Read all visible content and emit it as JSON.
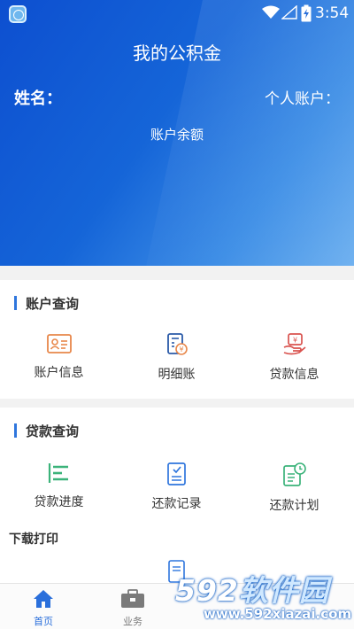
{
  "status_bar": {
    "time": "3:54"
  },
  "header": {
    "title": "我的公积金",
    "name_label": "姓名：",
    "account_label": "个人账户：",
    "balance_label": "账户余额"
  },
  "account_query": {
    "title": "账户查询",
    "items": [
      {
        "label": "账户信息",
        "icon": "id-card-icon"
      },
      {
        "label": "明细账",
        "icon": "calculator-icon"
      },
      {
        "label": "贷款信息",
        "icon": "loan-coin-icon"
      }
    ]
  },
  "loan_query": {
    "title": "贷款查询",
    "items": [
      {
        "label": "贷款进度",
        "icon": "progress-bars-icon"
      },
      {
        "label": "还款记录",
        "icon": "checklist-document-icon"
      },
      {
        "label": "还款计划",
        "icon": "schedule-clock-icon"
      }
    ]
  },
  "download_print": {
    "title": "下载打印"
  },
  "bottom_nav": {
    "items": [
      {
        "label": "首页",
        "icon": "home-icon",
        "active": true
      },
      {
        "label": "业务",
        "icon": "briefcase-icon",
        "active": false
      }
    ]
  },
  "watermark": {
    "brand_number": "592",
    "brand_text": "软件园",
    "url": "www.592xiazai.com"
  },
  "colors": {
    "primary": "#1565d8",
    "accent_blue": "#2f76dd",
    "orange_icon": "#e8874a",
    "green_icon": "#3bb37a"
  }
}
